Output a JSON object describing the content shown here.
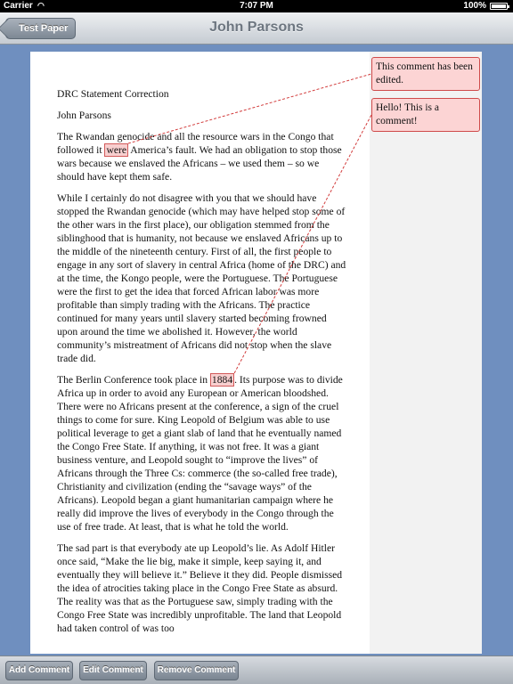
{
  "status_bar": {
    "carrier": "Carrier",
    "wifi": "◠",
    "time": "7:07 PM",
    "battery": "100%"
  },
  "nav": {
    "back_label": "Test Paper",
    "title": "John Parsons"
  },
  "document": {
    "heading": "DRC Statement Correction",
    "author": "John Parsons",
    "p1": {
      "before": "The Rwandan genocide and all the resource wars in the Congo that followed it ",
      "highlight": "were",
      "after": " America’s fault. We had an obligation to stop those wars because we enslaved the Africans – we used them – so we should have kept them safe."
    },
    "p2": "While I certainly do not disagree with you that we should have stopped the Rwandan genocide (which may have helped stop some of the other wars in the first place), our obligation stemmed from the siblinghood that is humanity, not because we enslaved Africans up to the middle of the nineteenth century. First of all, the first people to engage in any sort of slavery in central Africa (home of the DRC) and at the time, the Kongo people, were the Portuguese. The Portuguese were the first to get the idea that forced African labor was more profitable than simply trading with the Africans. The practice continued for many years until slavery started becoming frowned upon around the time we abolished it. However, the world community’s mistreatment of Africans did not stop when the slave trade did.",
    "p3": {
      "before": "The Berlin Conference took place in ",
      "highlight": "1884",
      "after": ". Its purpose was to divide Africa up in order to avoid any European or American bloodshed. There were no Africans present at the conference, a sign of the cruel things to come for sure. King Leopold of Belgium was able to use political leverage to get a giant slab of land that he eventually named the Congo Free State. If anything, it was not free. It was a giant business venture, and Leopold sought to “improve the lives” of Africans through the Three Cs: commerce (the so-called free trade), Christianity and civilization (ending the “savage ways” of the Africans). Leopold began a giant humanitarian campaign where he really did improve the lives of everybody in the Congo through the use of free trade. At least, that is what he told the world."
    },
    "p4": "The sad part is that everybody ate up Leopold’s lie. As Adolf Hitler once said, “Make the lie big, make it simple, keep saying it, and eventually they will believe it.” Believe it they did. People dismissed the idea of atrocities taking place in the Congo Free State as absurd. The reality was that as the Portuguese saw, simply trading with the Congo Free State was incredibly unprofitable. The land that Leopold had taken control of was too"
  },
  "comments": [
    {
      "text": "This comment has been edited."
    },
    {
      "text": "Hello! This is a comment!"
    }
  ],
  "toolbar": {
    "add": "Add Comment",
    "edit": "Edit Comment",
    "remove": "Remove Comment"
  },
  "colors": {
    "comment_fill": "#fcd4d4",
    "comment_border": "#cf4a4a",
    "connector": "#d23c3c",
    "background": "#6f8fbf"
  }
}
